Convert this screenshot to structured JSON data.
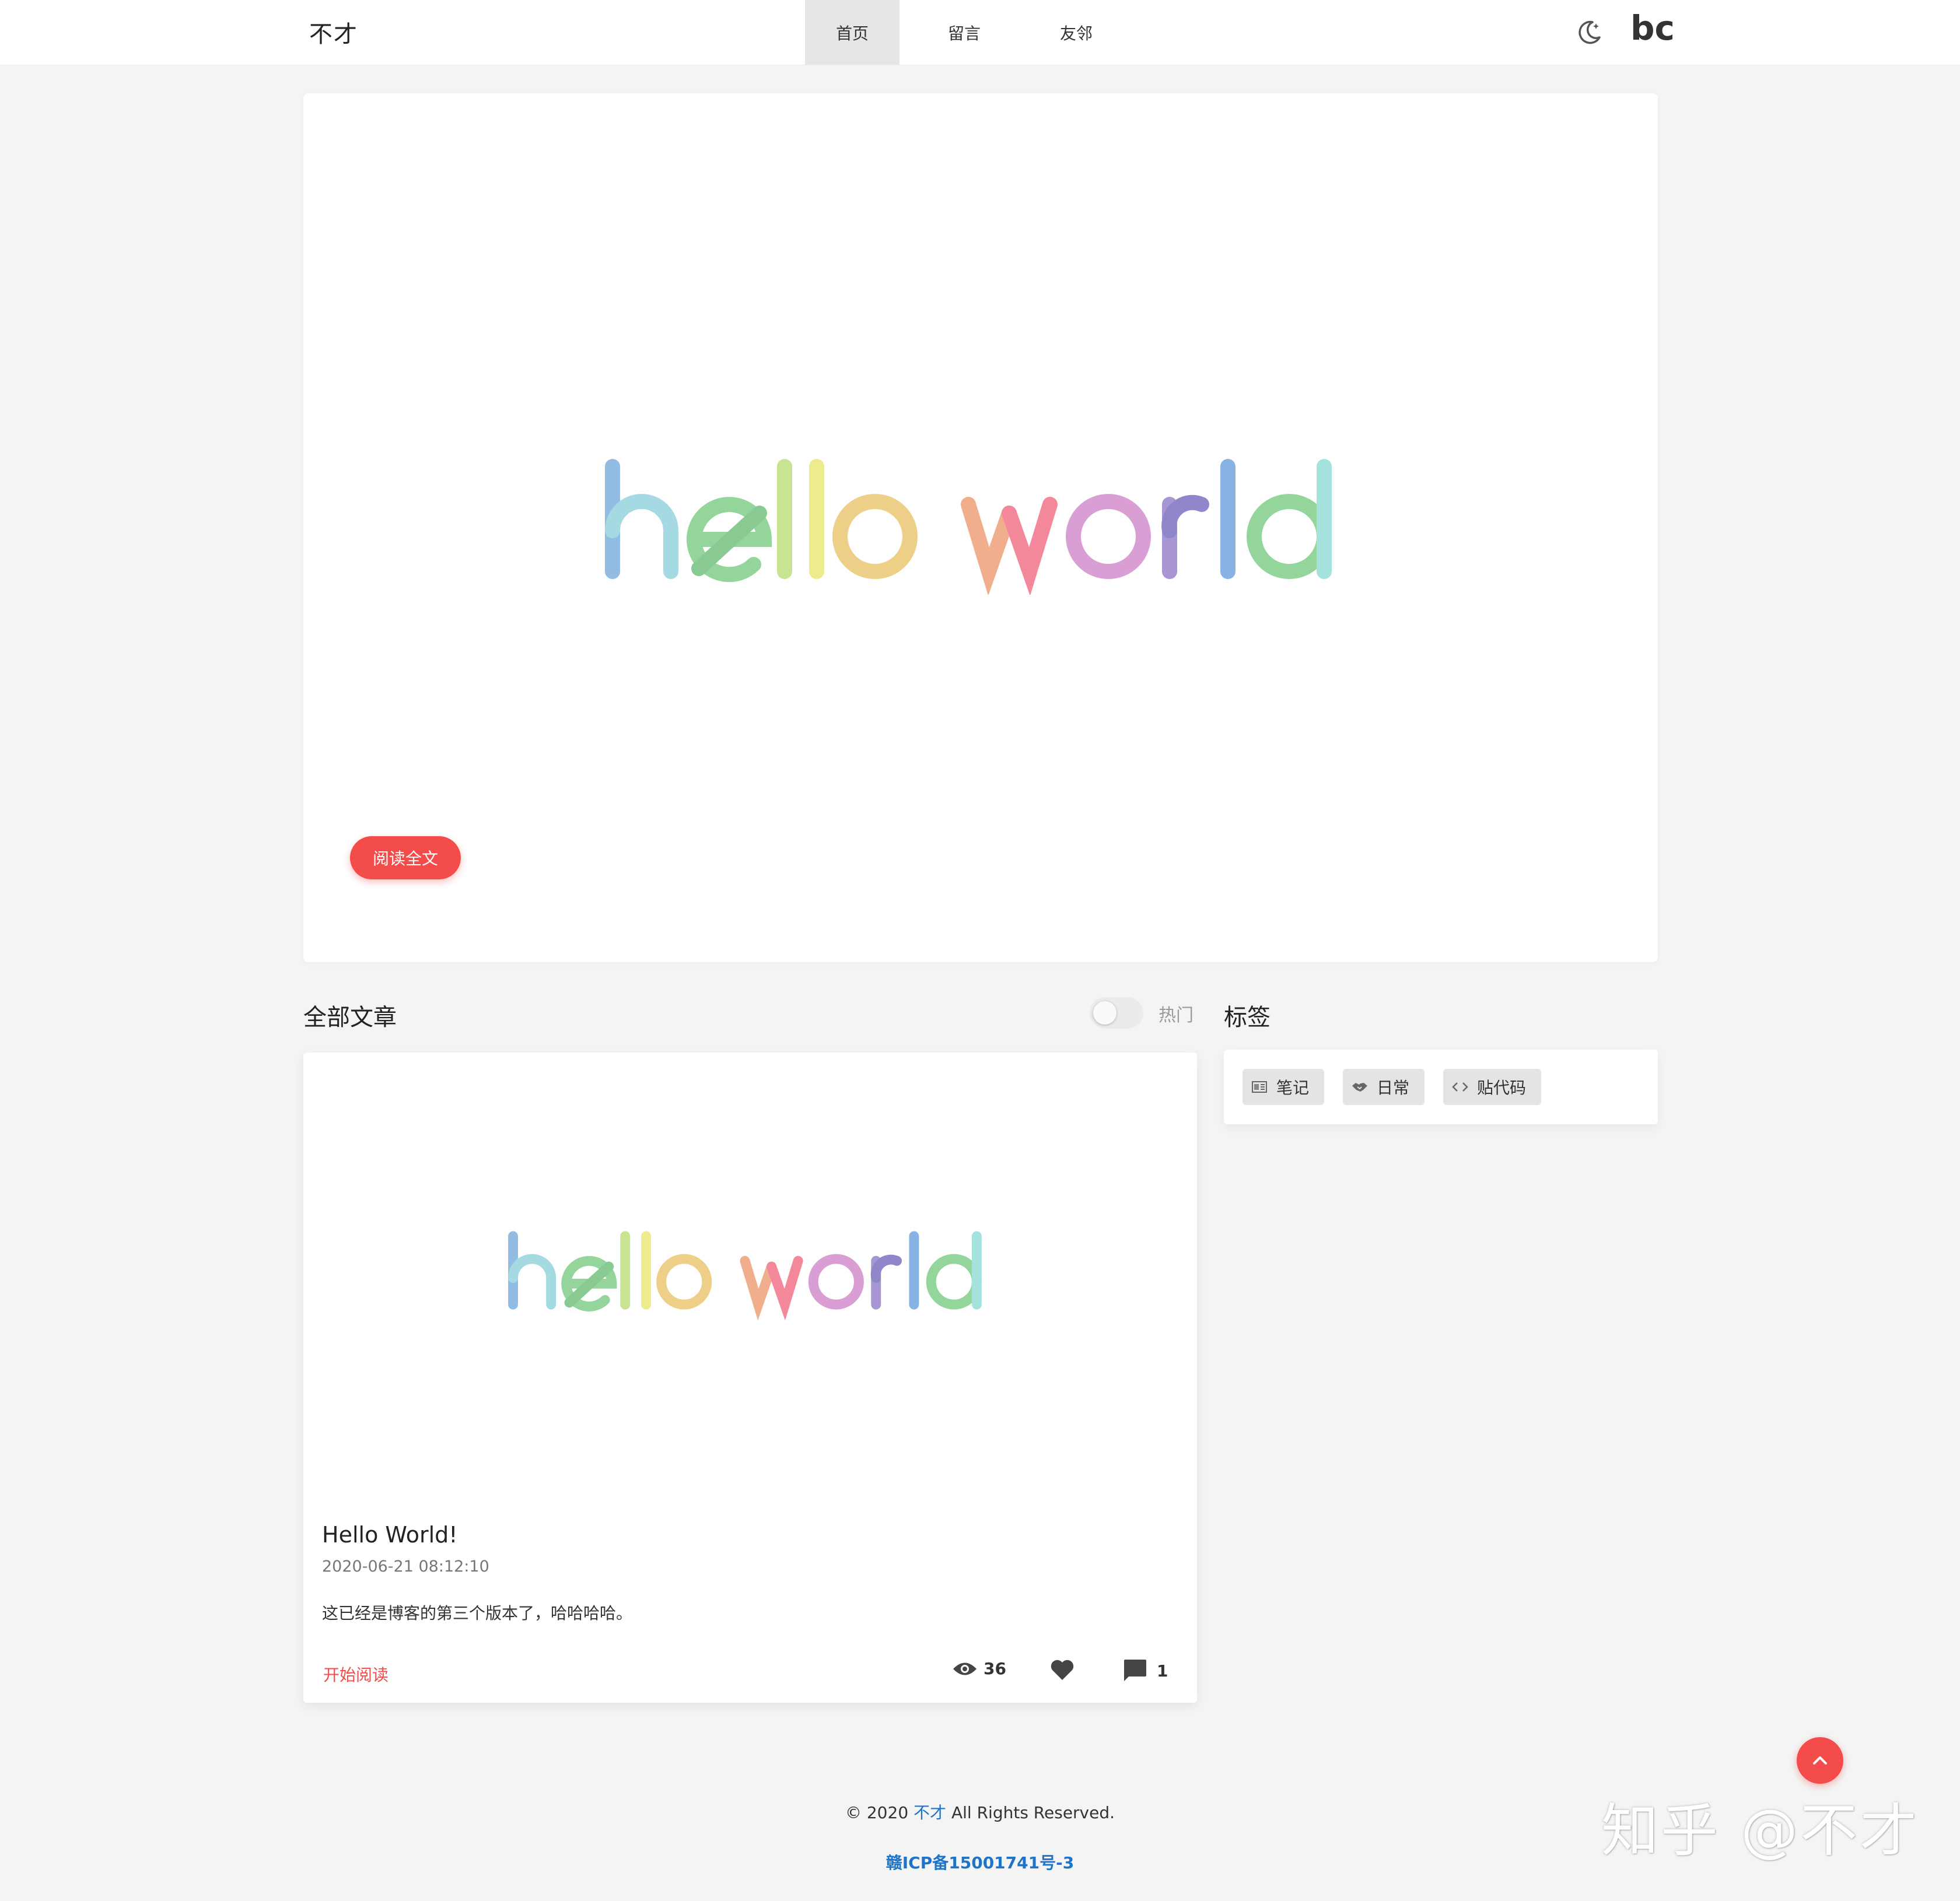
{
  "header": {
    "brand": "不才",
    "nav": [
      {
        "label": "首页",
        "active": true
      },
      {
        "label": "留言",
        "active": false
      },
      {
        "label": "友邻",
        "active": false
      }
    ],
    "theme_icon": "moon-icon",
    "logo": "bc"
  },
  "hero": {
    "cover_icon": "hello-world-cover",
    "read_full_label": "阅读全文"
  },
  "posts_section": {
    "title": "全部文章",
    "hot_toggle_label": "热门",
    "hot_toggle_on": false
  },
  "post": {
    "cover_icon": "hello-world-cover",
    "title": "Hello World!",
    "date": "2020-06-21 08:12:10",
    "excerpt": "这已经是博客的第三个版本了，哈哈哈哈。",
    "start_read_label": "开始阅读",
    "views": "36",
    "comments": "1",
    "icons": {
      "views": "eye-icon",
      "like": "heart-icon",
      "comments": "comment-icon"
    }
  },
  "tags_section": {
    "title": "标签",
    "tags": [
      {
        "label": "笔记",
        "icon": "notes-icon"
      },
      {
        "label": "日常",
        "icon": "handshake-icon"
      },
      {
        "label": "贴代码",
        "icon": "code-icon"
      }
    ]
  },
  "footer": {
    "copy_prefix": "© 2020",
    "author": "不才",
    "copy_suffix": "All Rights Reserved.",
    "icp": "赣ICP备15001741号-3"
  },
  "watermark": "知乎 @不才",
  "colors": {
    "accent": "#f44b4b",
    "link": "#1e74c8",
    "background": "#f4f4f4",
    "card": "#ffffff"
  }
}
